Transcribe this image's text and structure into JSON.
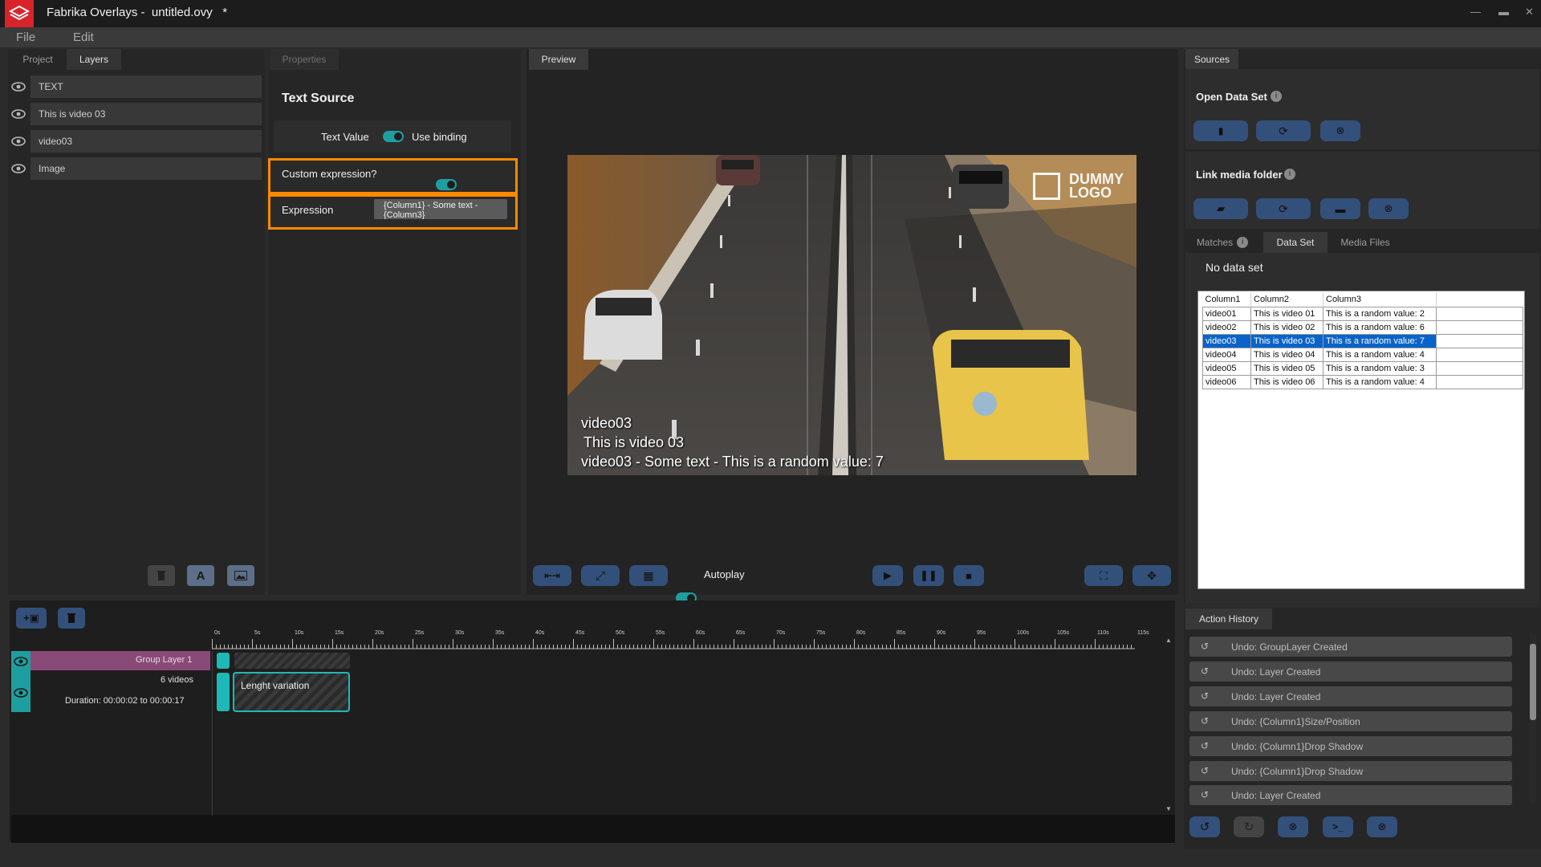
{
  "window": {
    "app_name": "Fabrika Overlays -",
    "file_name": "untitled.ovy",
    "modified_mark": "*"
  },
  "menu": [
    "File",
    "Edit"
  ],
  "left_panel": {
    "tabs": [
      "Project",
      "Layers"
    ],
    "active_tab": "Layers",
    "layers": [
      "TEXT",
      "This is video 03",
      "video03",
      "Image"
    ]
  },
  "properties": {
    "tab": "Properties",
    "title": "Text Source",
    "text_value_label": "Text Value",
    "use_binding_label": "Use binding",
    "custom_expression_label": "Custom expression?",
    "expression_label": "Expression",
    "expression_value": "{Column1} - Some text - {Column3}"
  },
  "preview": {
    "tab": "Preview",
    "logo_line1": "DUMMY",
    "logo_line2": "LOGO",
    "overlay_line1": "video03",
    "overlay_line2": "This is video 03",
    "overlay_line3": "video03 - Some text -  This is a random value: 7",
    "autoplay_label": "Autoplay"
  },
  "sources": {
    "tab": "Sources",
    "open_data_set_label": "Open Data Set",
    "link_media_folder_label": "Link media folder",
    "subtabs": [
      "Matches",
      "Data Set",
      "Media Files"
    ],
    "active_subtab": "Data Set",
    "no_data_label": "No data set",
    "columns": [
      "Column1",
      "Column2",
      "Column3"
    ],
    "rows": [
      [
        "video01",
        "This is video 01",
        "This is a random value: 2"
      ],
      [
        "video02",
        "This is video 02",
        "This is a random value: 6"
      ],
      [
        "video03",
        "This is video 03",
        "This is a random value: 7"
      ],
      [
        "video04",
        "This is video 04",
        "This is a random value: 4"
      ],
      [
        "video05",
        "This is video 05",
        "This is a random value: 3"
      ],
      [
        "video06",
        "This is video 06",
        "This is a random value: 4"
      ]
    ],
    "selected_row": 2
  },
  "timeline": {
    "group_label": "Group Layer 1",
    "videos_count": "6 videos",
    "duration": "Duration: 00:00:02 to 00:00:17",
    "clip_label": "Lenght variation",
    "ticks": [
      "0s",
      "5s",
      "10s",
      "15s",
      "20s",
      "25s",
      "30s",
      "35s",
      "40s",
      "45s",
      "50s",
      "55s",
      "60s",
      "65s",
      "70s",
      "75s",
      "80s",
      "85s",
      "90s",
      "95s",
      "100s",
      "105s",
      "110s",
      "115s"
    ]
  },
  "action_history": {
    "tab": "Action History",
    "items": [
      "Undo: GroupLayer Created",
      "Undo: Layer Created",
      "Undo: Layer Created",
      "Undo: {Column1}Size/Position",
      "Undo: {Column1}Drop Shadow",
      "Undo: {Column1}Drop Shadow",
      "Undo: Layer Created"
    ]
  },
  "colors": {
    "accent": "#1f9ea0",
    "highlight": "#ff8a00",
    "selection": "#0a63c9",
    "brand": "#d8232a",
    "group_bar": "#8a4a78"
  }
}
